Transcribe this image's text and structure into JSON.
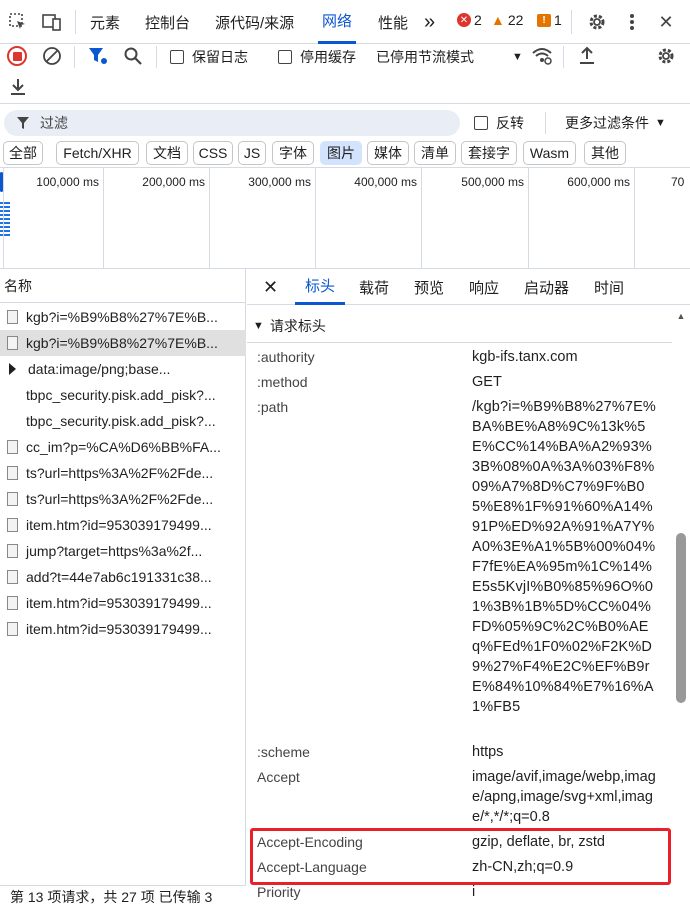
{
  "tabs": {
    "elements": "元素",
    "console": "控制台",
    "sources": "源代码/来源",
    "network": "网络",
    "performance": "性能",
    "more": "»"
  },
  "counts": {
    "errors": "2",
    "warnings": "22",
    "issues": "1"
  },
  "toolbar": {
    "preserve_log": "保留日志",
    "disable_cache": "停用缓存",
    "throttling": "已停用节流模式"
  },
  "filter": {
    "placeholder": "过滤",
    "invert": "反转",
    "more_filters": "更多过滤条件"
  },
  "chips": [
    "全部",
    "Fetch/XHR",
    "文档",
    "CSS",
    "JS",
    "字体",
    "图片",
    "媒体",
    "清单",
    "套接字",
    "Wasm",
    "其他"
  ],
  "timeline_ticks": [
    "100,000 ms",
    "200,000 ms",
    "300,000 ms",
    "400,000 ms",
    "500,000 ms",
    "600,000 ms",
    "70"
  ],
  "list": {
    "header": "名称",
    "items": [
      "kgb?i=%B9%B8%27%7E%B...",
      "kgb?i=%B9%B8%27%7E%B...",
      "data:image/png;base...",
      "tbpc_security.pisk.add_pisk?...",
      "tbpc_security.pisk.add_pisk?...",
      "cc_im?p=%CA%D6%BB%FA...",
      "ts?url=https%3A%2F%2Fde...",
      "ts?url=https%3A%2F%2Fde...",
      "item.htm?id=953039179499...",
      "jump?target=https%3a%2f...",
      "add?t=44e7ab6c191331c38...",
      "item.htm?id=953039179499...",
      "item.htm?id=953039179499..."
    ]
  },
  "detail_tabs": {
    "headers": "标头",
    "payload": "载荷",
    "preview": "预览",
    "response": "响应",
    "initiator": "启动器",
    "timing": "时间"
  },
  "section_title": "请求标头",
  "headers": [
    {
      "name": ":authority",
      "value": "kgb-ifs.tanx.com"
    },
    {
      "name": ":method",
      "value": "GET"
    },
    {
      "name": ":path",
      "value": "/kgb?i=%B9%B8%27%7E%BA%BE%A8%9C%13k%5E%CC%14%BA%A2%93%3B%08%0A%3A%03%F8%09%A7%8D%C7%9F%B05%E8%1F%91%60%A14%91P%ED%92A%91%A7Y%A0%3E%A1%5B%00%04%F7fE%EA%95m%1C%14%E5s5KvjI%B0%85%96O%01%3B%1B%5D%CC%04%FD%05%9C%2C%B0%AEq%FEd%1F0%02%F2K%D9%27%F4%E2C%EF%B9rE%84%10%84%E7%16%A1%FB5"
    },
    {
      "name": ":scheme",
      "value": "https"
    },
    {
      "name": "Accept",
      "value": "image/avif,image/webp,image/apng,image/svg+xml,image/*,*/*;q=0.8"
    },
    {
      "name": "Accept-Encoding",
      "value": "gzip, deflate, br, zstd"
    },
    {
      "name": "Accept-Language",
      "value": "zh-CN,zh;q=0.9"
    },
    {
      "name": "Priority",
      "value": "i"
    }
  ],
  "status": "第 13 项请求，共 27 项  已传输 3"
}
